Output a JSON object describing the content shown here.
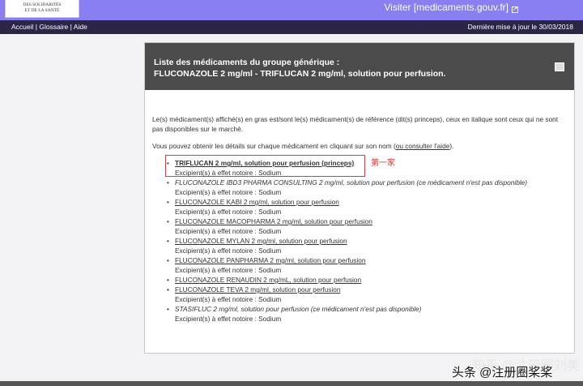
{
  "header": {
    "logo_lines": [
      "DES SOLIDARITÉS",
      "ET DE LA SANTÉ"
    ],
    "visit_link": "Visiter [medicaments.gouv.fr]",
    "external_icon": "external-link-icon"
  },
  "nav": {
    "items": [
      "Accueil",
      "Glossaire",
      "Aide"
    ],
    "separator": "|",
    "last_update": "Dernière mise à jour le 30/03/2018"
  },
  "panel": {
    "title_line1": "Liste des médicaments du groupe générique :",
    "title_line2": "FLUCONAZOLE 2 mg/ml - TRIFLUCAN 2 mg/ml, solution pour perfusion.",
    "print_icon": "print-icon",
    "intro": "Le(s) médicament(s) affiché(s) en gras est/sont le(s) médicament(s) de référence (dit(s) princeps), ceux en italique sont ceux qui ne sont pas disponibles sur le marché.",
    "details_text": "Vous pouvez obtenir les détails sur chaque médicament en cliquant sur son nom (",
    "help_link": "ou consulter l'aide",
    "details_end": ").",
    "items": [
      {
        "name": "TRIFLUCAN 2 mg/ml, solution pour perfusion (princeps)",
        "style": "bold",
        "excipient": "Excipient(s) à effet notoire : Sodium"
      },
      {
        "name": "FLUCONAZOLE IBD3 PHARMA CONSULTING 2 mg/ml, solution pour perfusion (ce médicament n'est pas disponible)",
        "style": "italic",
        "excipient": "Excipient(s) à effet notoire : Sodium"
      },
      {
        "name": "FLUCONAZOLE KABI 2 mg/ml, solution pour perfusion",
        "style": "link",
        "excipient": "Excipient(s) à effet notoire : Sodium"
      },
      {
        "name": "FLUCONAZOLE MACOPHARMA 2 mg/ml, solution pour perfusion",
        "style": "link",
        "excipient": "Excipient(s) à effet notoire : Sodium"
      },
      {
        "name": "FLUCONAZOLE MYLAN 2 mg/ml, solution pour perfusion",
        "style": "link",
        "excipient": "Excipient(s) à effet notoire : Sodium"
      },
      {
        "name": "FLUCONAZOLE PANPHARMA 2 mg/ml, solution pour perfusion",
        "style": "link",
        "excipient": "Excipient(s) à effet notoire : Sodium"
      },
      {
        "name": "FLUCONAZOLE RENAUDIN 2 mg/mL, solution pour perfusion",
        "style": "link",
        "excipient": ""
      },
      {
        "name": "FLUCONAZOLE TEVA 2 mg/ml, solution pour perfusion",
        "style": "link",
        "excipient": "Excipient(s) à effet notoire : Sodium"
      },
      {
        "name": "STASIFLUC 2 mg/ml, solution pour perfusion (ce médicament n'est pas disponible)",
        "style": "italic",
        "excipient": "Excipient(s) à effet notoire : Sodium"
      }
    ],
    "annotation": "第一家"
  },
  "watermark": {
    "faint": "知乎 @注册圈刘美",
    "main": "头条 @注册圈桨桨"
  }
}
